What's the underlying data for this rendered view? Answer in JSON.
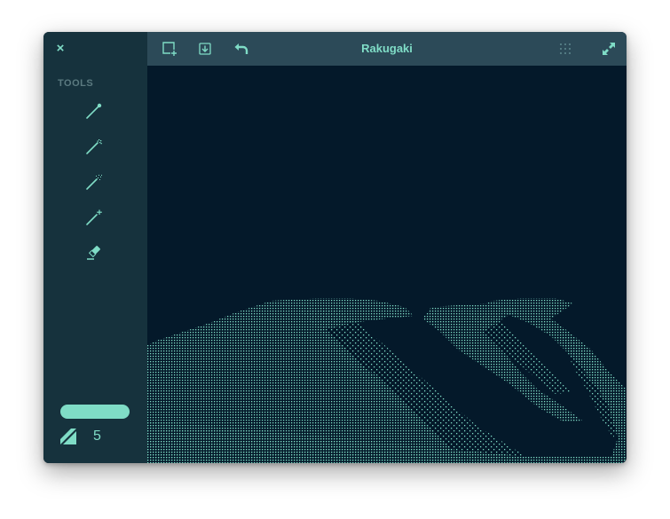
{
  "window": {
    "title": "Rakugaki"
  },
  "sidebar": {
    "close_label": "×",
    "tools_heading": "TOOLS",
    "tools": [
      {
        "name": "pen-tool",
        "icon": "pen-icon"
      },
      {
        "name": "sparkle-brush-tool",
        "icon": "sparkle-brush-icon"
      },
      {
        "name": "spray-tool",
        "icon": "spray-brush-icon"
      },
      {
        "name": "star-brush-tool",
        "icon": "star-brush-icon"
      },
      {
        "name": "eraser-tool",
        "icon": "eraser-icon"
      }
    ],
    "color": "#7fdcc6",
    "brush_size": "5"
  },
  "toolbar": {
    "new_icon": "new-canvas-icon",
    "save_icon": "save-download-icon",
    "undo_icon": "undo-icon",
    "grid_icon": "grid-dots-icon",
    "fullscreen_icon": "fullscreen-icon"
  },
  "colors": {
    "accent": "#7fdcc6",
    "sidebar": "#16323d",
    "header": "#2c4a58",
    "canvas": "#04192a"
  }
}
